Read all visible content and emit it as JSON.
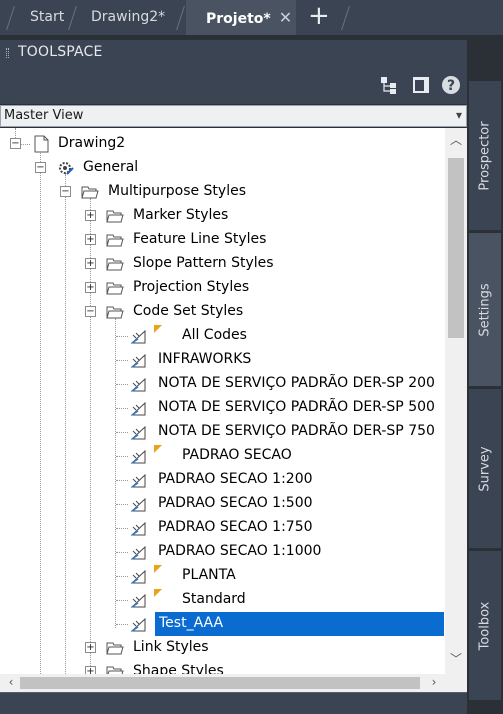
{
  "tabs": [
    {
      "label": "Start"
    },
    {
      "label": "Drawing2*"
    },
    {
      "label": "Projeto*"
    }
  ],
  "new_tab": "+",
  "close_glyph": "✕",
  "toolspace": {
    "title": "TOOLSPACE"
  },
  "toolbar": {
    "icons": [
      "tree-view-icon",
      "panel-icon",
      "help-icon"
    ],
    "help_glyph": "?"
  },
  "view_combo": {
    "value": "Master View"
  },
  "tree": {
    "root": "Drawing2",
    "general": "General",
    "multipurpose": "Multipurpose Styles",
    "folders": [
      "Marker Styles",
      "Feature Line Styles",
      "Slope Pattern Styles",
      "Projection Styles",
      "Code Set Styles"
    ],
    "code_sets": [
      "All Codes",
      "INFRAWORKS",
      "NOTA DE SERVIÇO PADRÃO DER-SP 200",
      "NOTA DE SERVIÇO PADRÃO DER-SP 500",
      "NOTA DE SERVIÇO PADRÃO DER-SP 750",
      "PADRAO SECAO",
      "PADRAO SECAO 1:200",
      "PADRAO SECAO 1:500",
      "PADRAO SECAO 1:750",
      "PADRAO SECAO 1:1000",
      "PLANTA",
      "Standard",
      "Test_AAA"
    ],
    "after": [
      "Link Styles",
      "Shape Styles"
    ]
  },
  "side_tabs": [
    {
      "label": "Prospector"
    },
    {
      "label": "Settings"
    },
    {
      "label": "Survey"
    },
    {
      "label": "Toolbox"
    }
  ],
  "colors": {
    "selection": "#0a6cd1",
    "panel": "#3b4453",
    "background": "#2b2f36"
  }
}
